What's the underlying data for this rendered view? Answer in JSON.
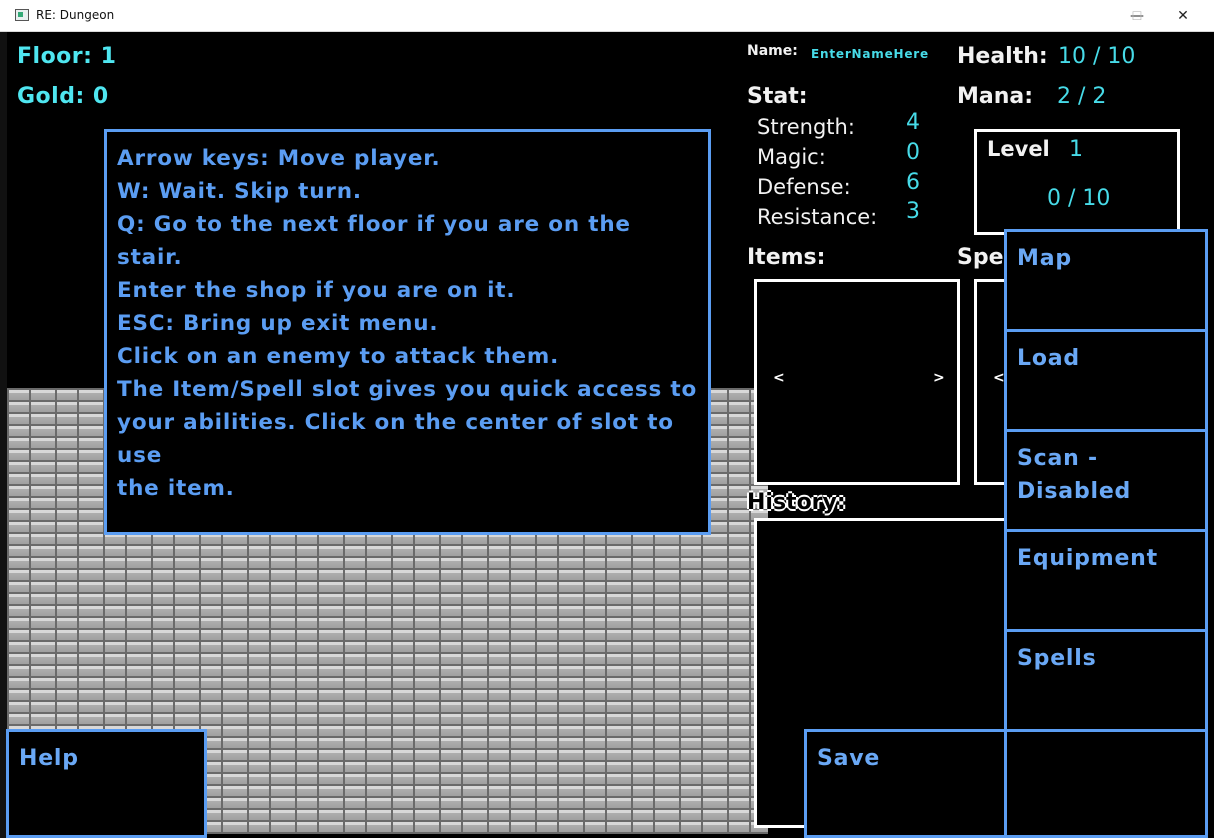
{
  "window": {
    "title": "RE: Dungeon",
    "minimize": "—",
    "maximize": "☐",
    "close": "✕"
  },
  "hud": {
    "floor": "Floor: 1",
    "gold": "Gold: 0",
    "name_label": "Name:",
    "name_value": "EnterNameHere",
    "health_label": "Health:",
    "health_value": "10 / 10",
    "mana_label": "Mana:",
    "mana_value": "2 / 2"
  },
  "stats": {
    "title": "Stat:",
    "strength_label": "Strength:",
    "strength_value": "4",
    "magic_label": "Magic:",
    "magic_value": "0",
    "defense_label": "Defense:",
    "defense_value": "6",
    "resistance_label": "Resistance:",
    "resistance_value": "3"
  },
  "level": {
    "label": "Level",
    "value": "1",
    "xp": "0 / 10"
  },
  "items": {
    "label": "Items:",
    "prev": "<",
    "next": ">"
  },
  "spells_panel": {
    "label": "Spel",
    "prev": "<"
  },
  "history": {
    "label": "History:"
  },
  "help_dialog": {
    "lines": [
      "Arrow keys: Move player.",
      "W: Wait. Skip turn.",
      "Q: Go to the next floor if you are on the stair.",
      "Enter the shop if you are on it.",
      "ESC: Bring up exit menu.",
      "Click on an enemy to attack them.",
      "The Item/Spell slot gives you quick access to",
      "your abilities. Click on the center of slot to use",
      "the item."
    ]
  },
  "menu": {
    "map": "Map",
    "load": "Load",
    "scan": "Scan -",
    "scan2": "Disabled",
    "equipment": "Equipment",
    "spells": "Spells",
    "save": "Save",
    "help": "Help"
  },
  "colors": {
    "hud_cyan": "#4fe6f0",
    "button_blue": "#5b9df2",
    "background": "#000000"
  }
}
